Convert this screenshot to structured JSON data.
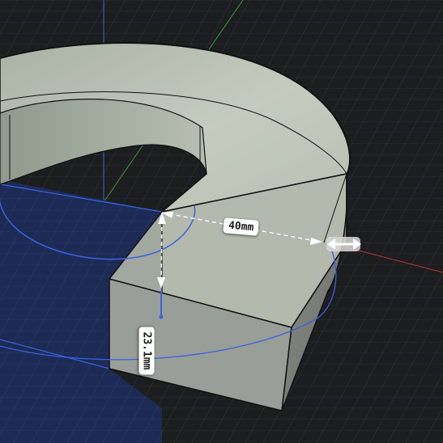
{
  "viewport": {
    "background_color": "#1c1d1f",
    "grid_color": "#2f3135",
    "model_face_color": "#b4bcae",
    "sketch_plane_color": "#1c2a55",
    "axis_colors": {
      "x": "#c0392b",
      "y": "#3a9a3a",
      "z": "#2f6fd6"
    },
    "sketch_profile_color": "#3a62e0"
  },
  "dimensions": {
    "radius": {
      "value": "40mm",
      "icon": "double-arrow-handle-icon"
    },
    "height": {
      "value": "23.1mm"
    }
  }
}
